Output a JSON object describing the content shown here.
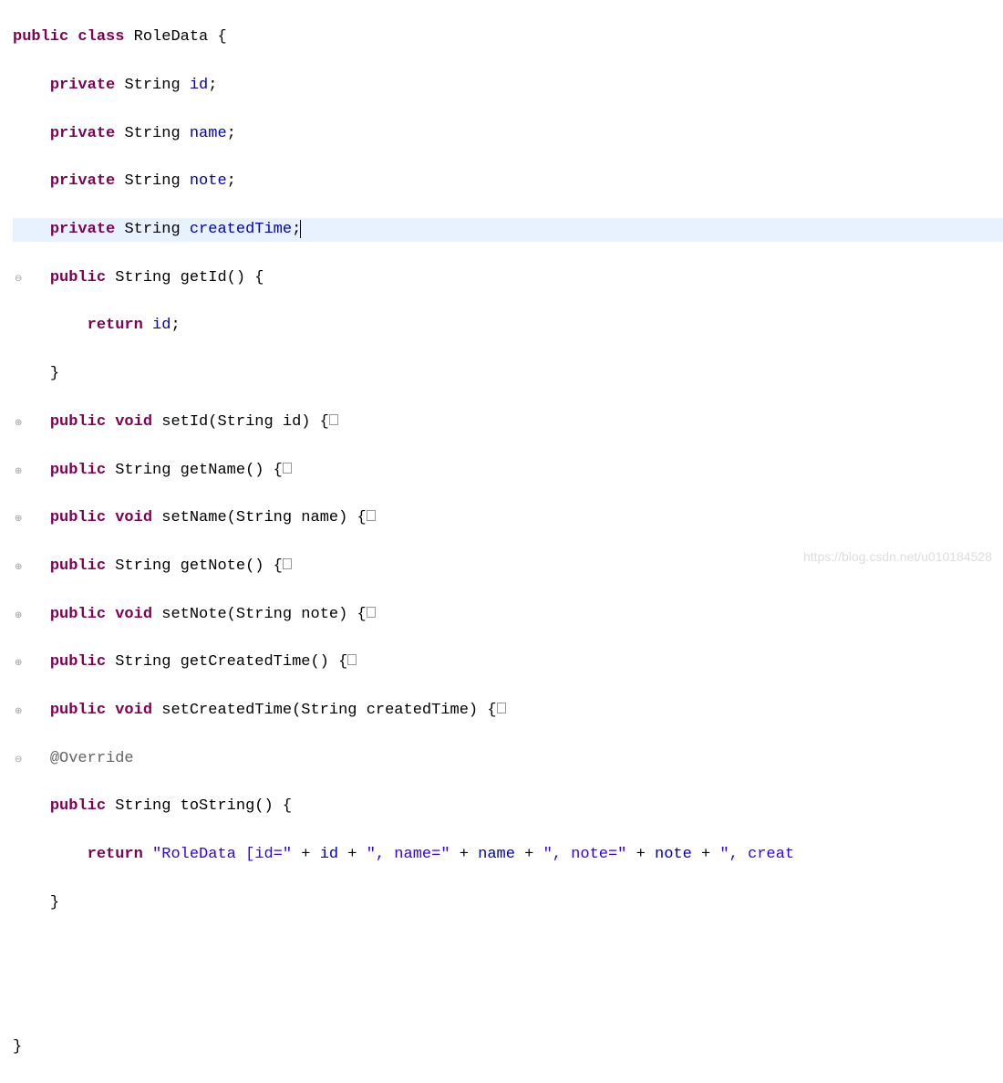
{
  "code": {
    "l1": {
      "kw1": "public",
      "kw2": "class",
      "name": "RoleData",
      "brace": "{"
    },
    "l2": {
      "kw": "private",
      "type": "String",
      "field": "id",
      "sc": ";"
    },
    "l3": {
      "kw": "private",
      "type": "String",
      "field": "name",
      "sc": ";"
    },
    "l4": {
      "kw": "private",
      "type": "String",
      "field": "note",
      "sc": ";"
    },
    "l5": {
      "kw": "private",
      "type": "String",
      "field": "createdTime",
      "sc": ";"
    },
    "l6": {
      "kw": "public",
      "type": "String",
      "meth": "getId",
      "paren": "()",
      "brace": " {"
    },
    "l7": {
      "kw": "return",
      "field": "id",
      "sc": ";"
    },
    "l8": {
      "brace": "}"
    },
    "l9": {
      "kw": "public",
      "ret": "void",
      "meth": "setId",
      "params": "(String id)",
      "brace": " {"
    },
    "l10": {
      "kw": "public",
      "ret": "String",
      "meth": "getName",
      "params": "()",
      "brace": " {"
    },
    "l11": {
      "kw": "public",
      "ret": "void",
      "meth": "setName",
      "params": "(String name)",
      "brace": " {"
    },
    "l12": {
      "kw": "public",
      "ret": "String",
      "meth": "getNote",
      "params": "()",
      "brace": " {"
    },
    "l13": {
      "kw": "public",
      "ret": "void",
      "meth": "setNote",
      "params": "(String note)",
      "brace": " {"
    },
    "l14": {
      "kw": "public",
      "ret": "String",
      "meth": "getCreatedTime",
      "params": "()",
      "brace": " {"
    },
    "l15": {
      "kw": "public",
      "ret": "void",
      "meth": "setCreatedTime",
      "params": "(String createdTime)",
      "brace": " {"
    },
    "l16": {
      "ann": "@Override"
    },
    "l17": {
      "kw": "public",
      "ret": "String",
      "meth": "toString",
      "params": "()",
      "brace": " {"
    },
    "l18": {
      "kw": "return",
      "s1": "\"RoleData [id=\"",
      "p1": " + ",
      "f1": "id",
      "p2": " + ",
      "s2": "\", name=\"",
      "p3": " + ",
      "f2": "name",
      "p4": " + ",
      "s3": "\", note=\"",
      "p5": " + ",
      "f3": "note",
      "p6": " + ",
      "s4": "\", creat"
    },
    "l19": {
      "brace": "}"
    },
    "l22": {
      "brace": "}"
    }
  },
  "gutter": {
    "minus": "⊖",
    "plus": "⊕"
  },
  "watermark": "https://blog.csdn.net/u010184528"
}
